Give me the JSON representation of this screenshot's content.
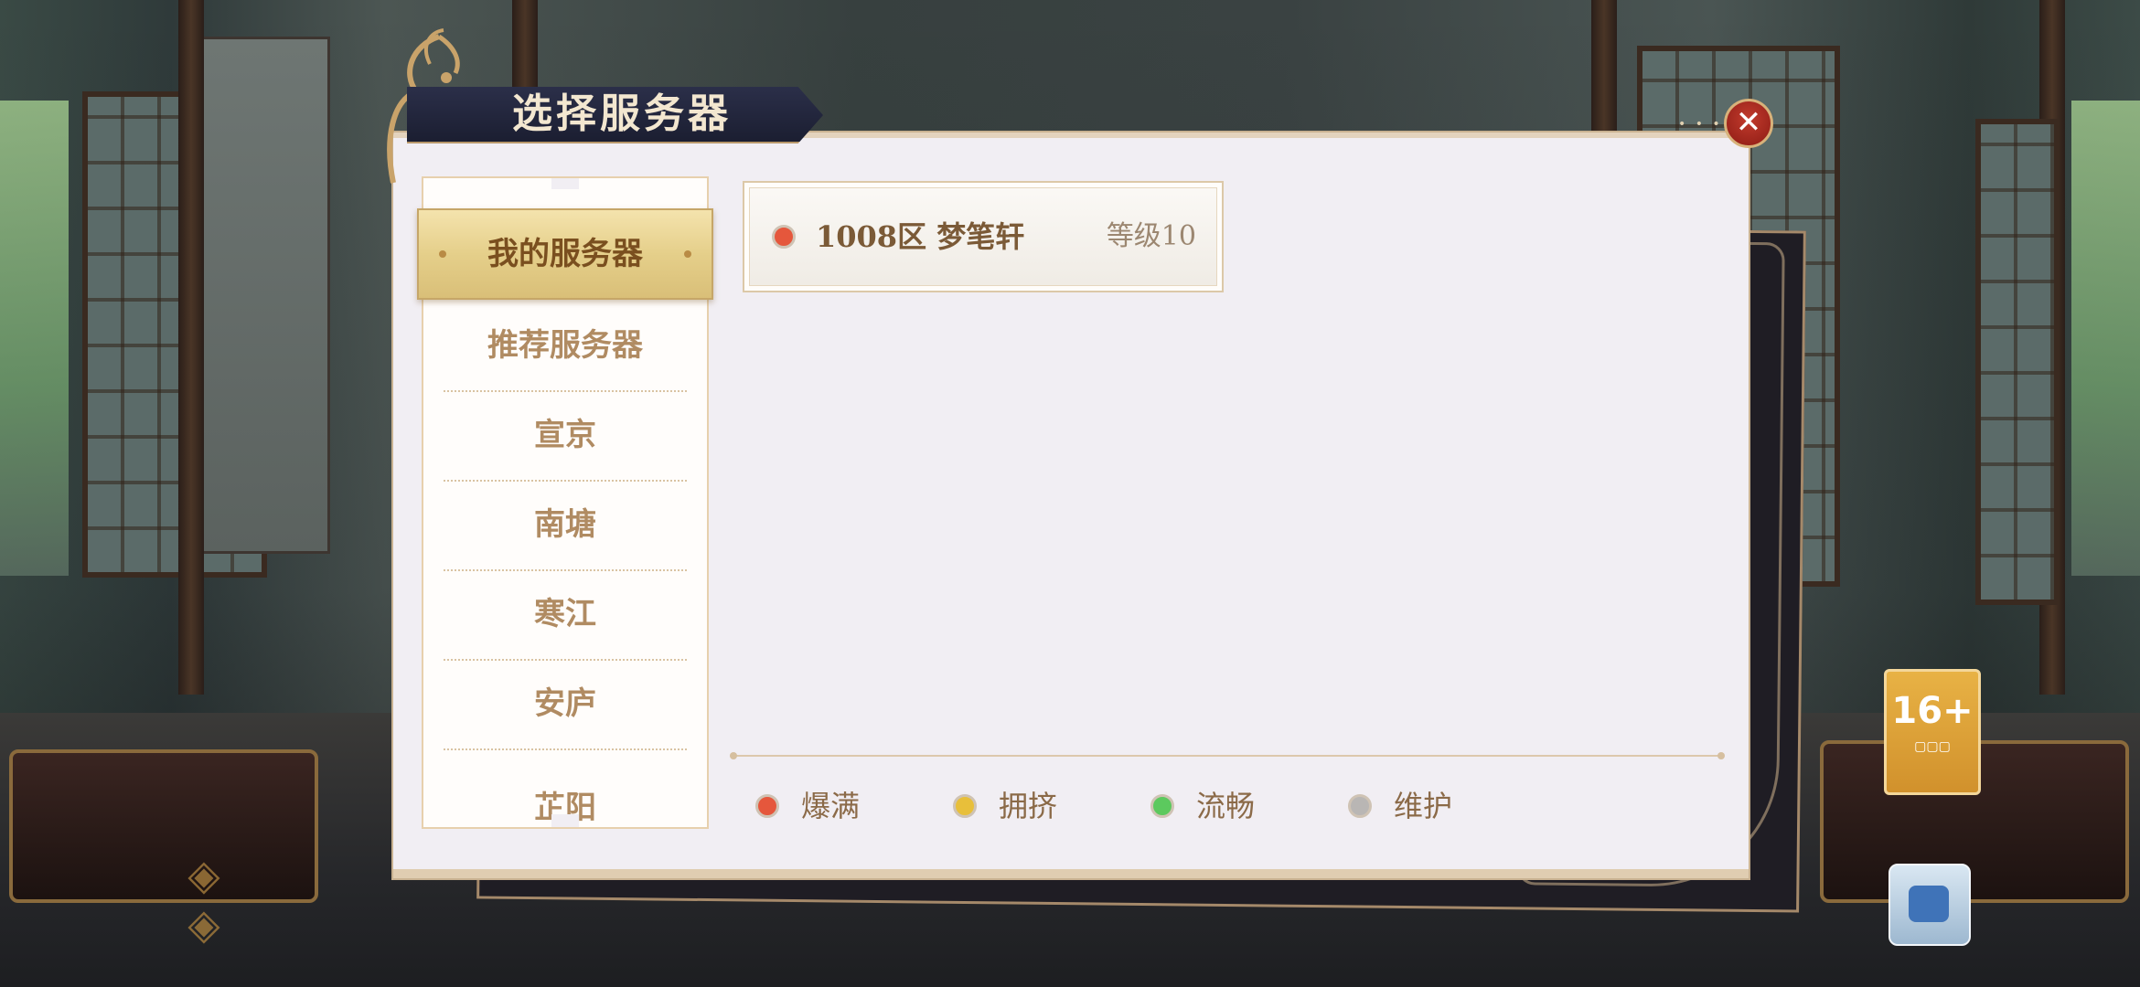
{
  "dialog": {
    "title": "选择服务器",
    "close_label": "✕"
  },
  "regions": {
    "active": "我的服务器",
    "items": [
      "推荐服务器",
      "宣京",
      "南塘",
      "寒江",
      "安庐",
      "芷阳"
    ]
  },
  "servers": [
    {
      "name": "1008区 梦笔轩",
      "level": "等级10",
      "status": "爆满",
      "status_color": "#e5573c"
    }
  ],
  "legend": [
    {
      "label": "爆满",
      "color": "#e5573c"
    },
    {
      "label": "拥挤",
      "color": "#e8bf3a"
    },
    {
      "label": "流畅",
      "color": "#5cc95e"
    },
    {
      "label": "维护",
      "color": "#b9b6b4"
    }
  ],
  "overlay": {
    "age_rating": "16+"
  }
}
